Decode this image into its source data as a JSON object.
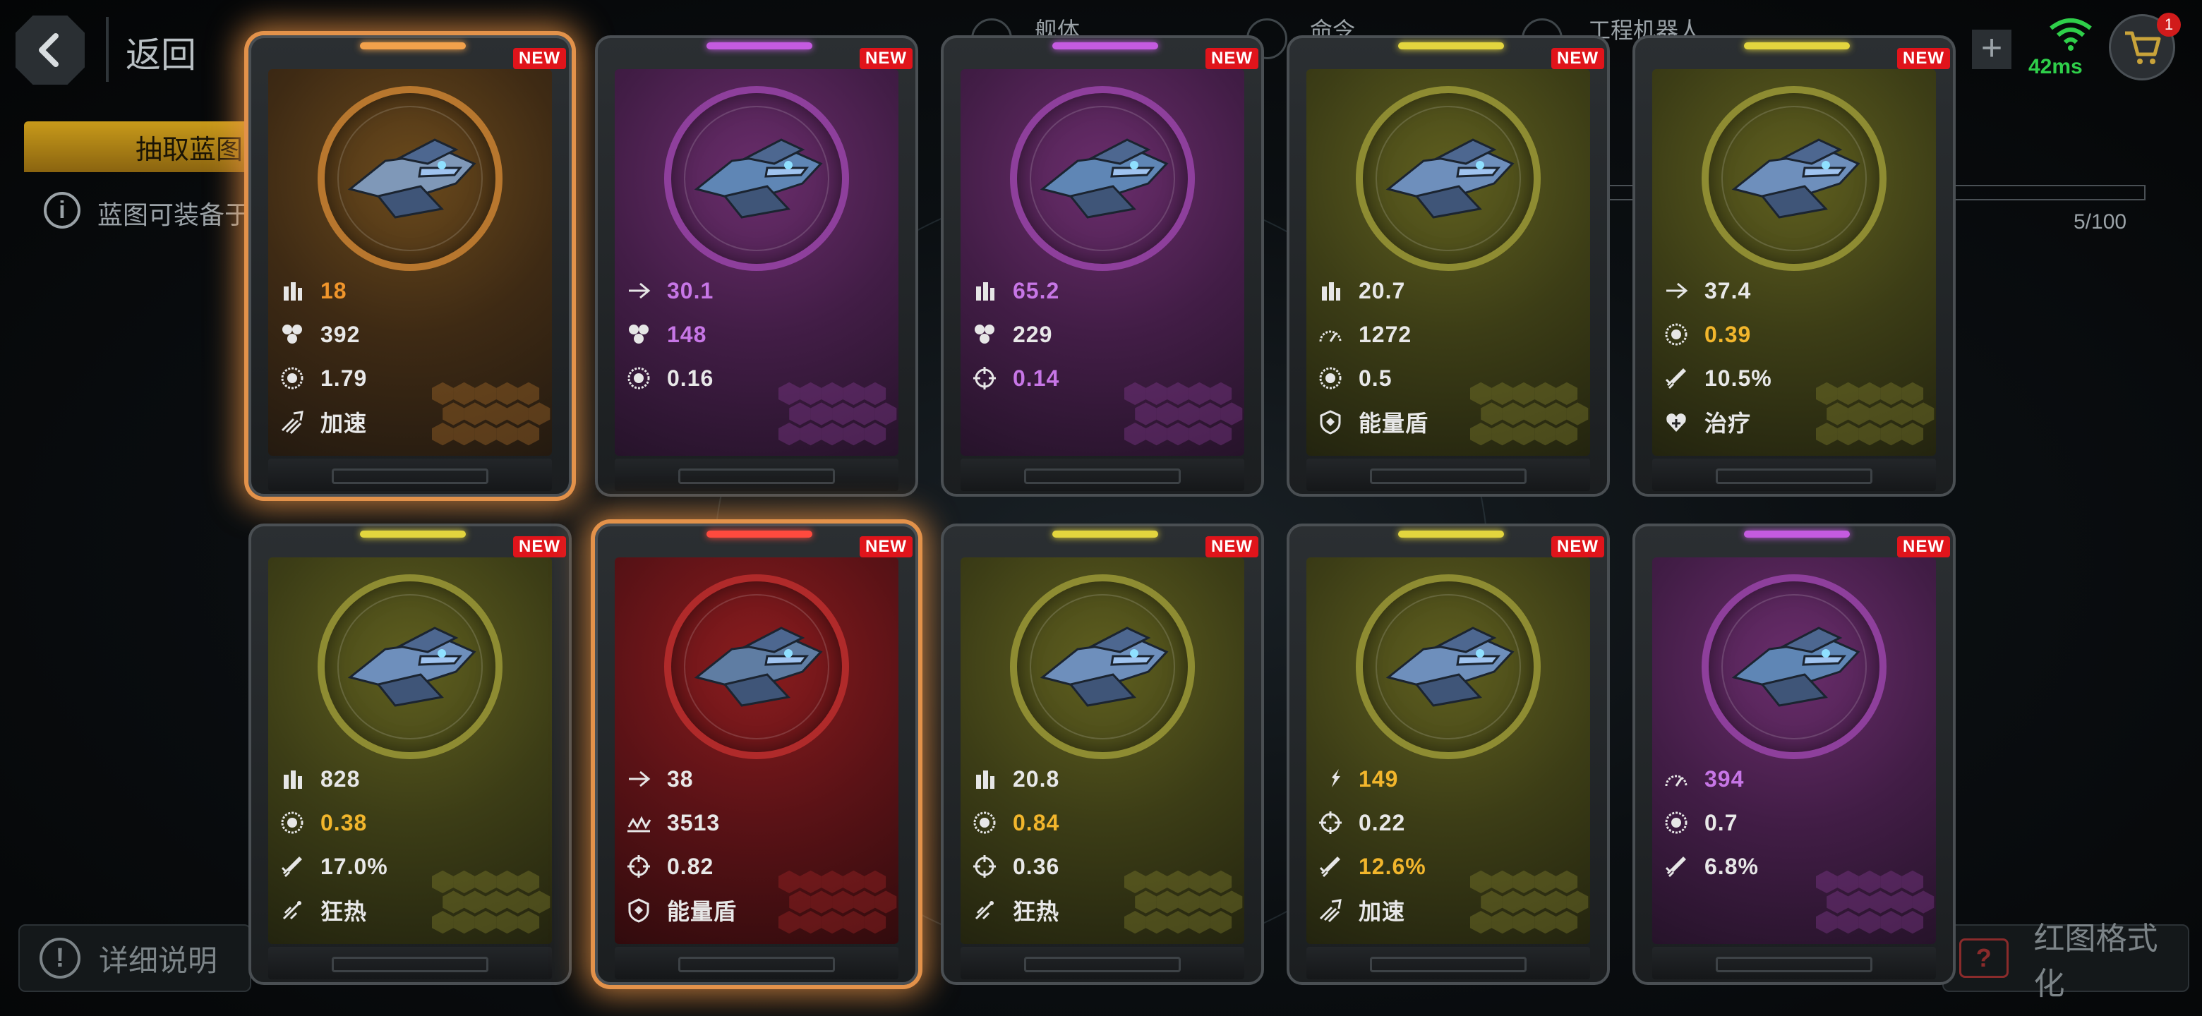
{
  "header": {
    "back_label": "返回",
    "tabs": [
      {
        "label": "舰体"
      },
      {
        "label": "命令"
      },
      {
        "label": "工程机器人"
      }
    ],
    "ping": "42ms",
    "cart_badge": "1"
  },
  "left_panel": {
    "draw_tab_label": "抽取蓝图",
    "info_text": "蓝图可装备于"
  },
  "progress": {
    "text": "5/100",
    "value": 0.05
  },
  "footer": {
    "detail_label": "详细说明",
    "format_label": "红图格式化",
    "format_icon_text": "?"
  },
  "colors": {
    "orange": "#f0952b",
    "purple": "#c776e6",
    "yellow": "#f2b62c",
    "white": "#e8e8e8",
    "new_badge": "#e0141b"
  },
  "cards": [
    {
      "rarity": "orange",
      "selected": true,
      "new": "NEW",
      "stats": [
        {
          "icon": "ammo-icon",
          "value": "18",
          "color": "orange"
        },
        {
          "icon": "cluster-icon",
          "value": "392",
          "color": "white"
        },
        {
          "icon": "target-ring-icon",
          "value": "1.79",
          "color": "white"
        },
        {
          "icon": "accelerate-icon",
          "value": "加速",
          "color": "white"
        }
      ]
    },
    {
      "rarity": "purple",
      "selected": false,
      "new": "NEW",
      "stats": [
        {
          "icon": "arrow-icon",
          "value": "30.1",
          "color": "purple"
        },
        {
          "icon": "cluster-icon",
          "value": "148",
          "color": "purple"
        },
        {
          "icon": "target-ring-icon",
          "value": "0.16",
          "color": "white"
        }
      ]
    },
    {
      "rarity": "purple",
      "selected": false,
      "new": "NEW",
      "stats": [
        {
          "icon": "ammo-icon",
          "value": "65.2",
          "color": "purple"
        },
        {
          "icon": "cluster-icon",
          "value": "229",
          "color": "white"
        },
        {
          "icon": "crosshair-icon",
          "value": "0.14",
          "color": "purple"
        }
      ]
    },
    {
      "rarity": "yellow",
      "selected": false,
      "new": "NEW",
      "stats": [
        {
          "icon": "ammo-icon",
          "value": "20.7",
          "color": "white"
        },
        {
          "icon": "gauge-icon",
          "value": "1272",
          "color": "white"
        },
        {
          "icon": "target-ring-icon",
          "value": "0.5",
          "color": "white"
        },
        {
          "icon": "shield-icon",
          "value": "能量盾",
          "color": "white"
        }
      ]
    },
    {
      "rarity": "yellow",
      "selected": false,
      "new": "NEW",
      "stats": [
        {
          "icon": "arrow-icon",
          "value": "37.4",
          "color": "white"
        },
        {
          "icon": "target-ring-icon",
          "value": "0.39",
          "color": "yellow"
        },
        {
          "icon": "missile-icon",
          "value": "10.5%",
          "color": "white"
        },
        {
          "icon": "heal-icon",
          "value": "治疗",
          "color": "white"
        }
      ]
    },
    {
      "rarity": "yellow",
      "selected": false,
      "new": "NEW",
      "stats": [
        {
          "icon": "ammo-icon",
          "value": "828",
          "color": "white"
        },
        {
          "icon": "target-ring-icon",
          "value": "0.38",
          "color": "yellow"
        },
        {
          "icon": "missile-icon",
          "value": "17.0%",
          "color": "white"
        },
        {
          "icon": "frenzy-icon",
          "value": "狂热",
          "color": "white"
        }
      ]
    },
    {
      "rarity": "red",
      "selected": true,
      "new": "NEW",
      "stats": [
        {
          "icon": "arrow-icon",
          "value": "38",
          "color": "white"
        },
        {
          "icon": "wave-icon",
          "value": "3513",
          "color": "white"
        },
        {
          "icon": "crosshair-icon",
          "value": "0.82",
          "color": "white"
        },
        {
          "icon": "shield-icon",
          "value": "能量盾",
          "color": "white"
        }
      ]
    },
    {
      "rarity": "yellow",
      "selected": false,
      "new": "NEW",
      "stats": [
        {
          "icon": "ammo-icon",
          "value": "20.8",
          "color": "white"
        },
        {
          "icon": "target-ring-icon",
          "value": "0.84",
          "color": "yellow"
        },
        {
          "icon": "crosshair-icon",
          "value": "0.36",
          "color": "white"
        },
        {
          "icon": "frenzy-icon",
          "value": "狂热",
          "color": "white"
        }
      ]
    },
    {
      "rarity": "yellow",
      "selected": false,
      "new": "NEW",
      "stats": [
        {
          "icon": "lightning-icon",
          "value": "149",
          "color": "yellow"
        },
        {
          "icon": "crosshair-icon",
          "value": "0.22",
          "color": "white"
        },
        {
          "icon": "missile-icon",
          "value": "12.6%",
          "color": "yellow"
        },
        {
          "icon": "accelerate-icon",
          "value": "加速",
          "color": "white"
        }
      ]
    },
    {
      "rarity": "purple",
      "selected": false,
      "new": "NEW",
      "stats": [
        {
          "icon": "gauge-icon",
          "value": "394",
          "color": "purple"
        },
        {
          "icon": "target-ring-icon",
          "value": "0.7",
          "color": "white"
        },
        {
          "icon": "missile-icon",
          "value": "6.8%",
          "color": "white"
        }
      ]
    }
  ]
}
